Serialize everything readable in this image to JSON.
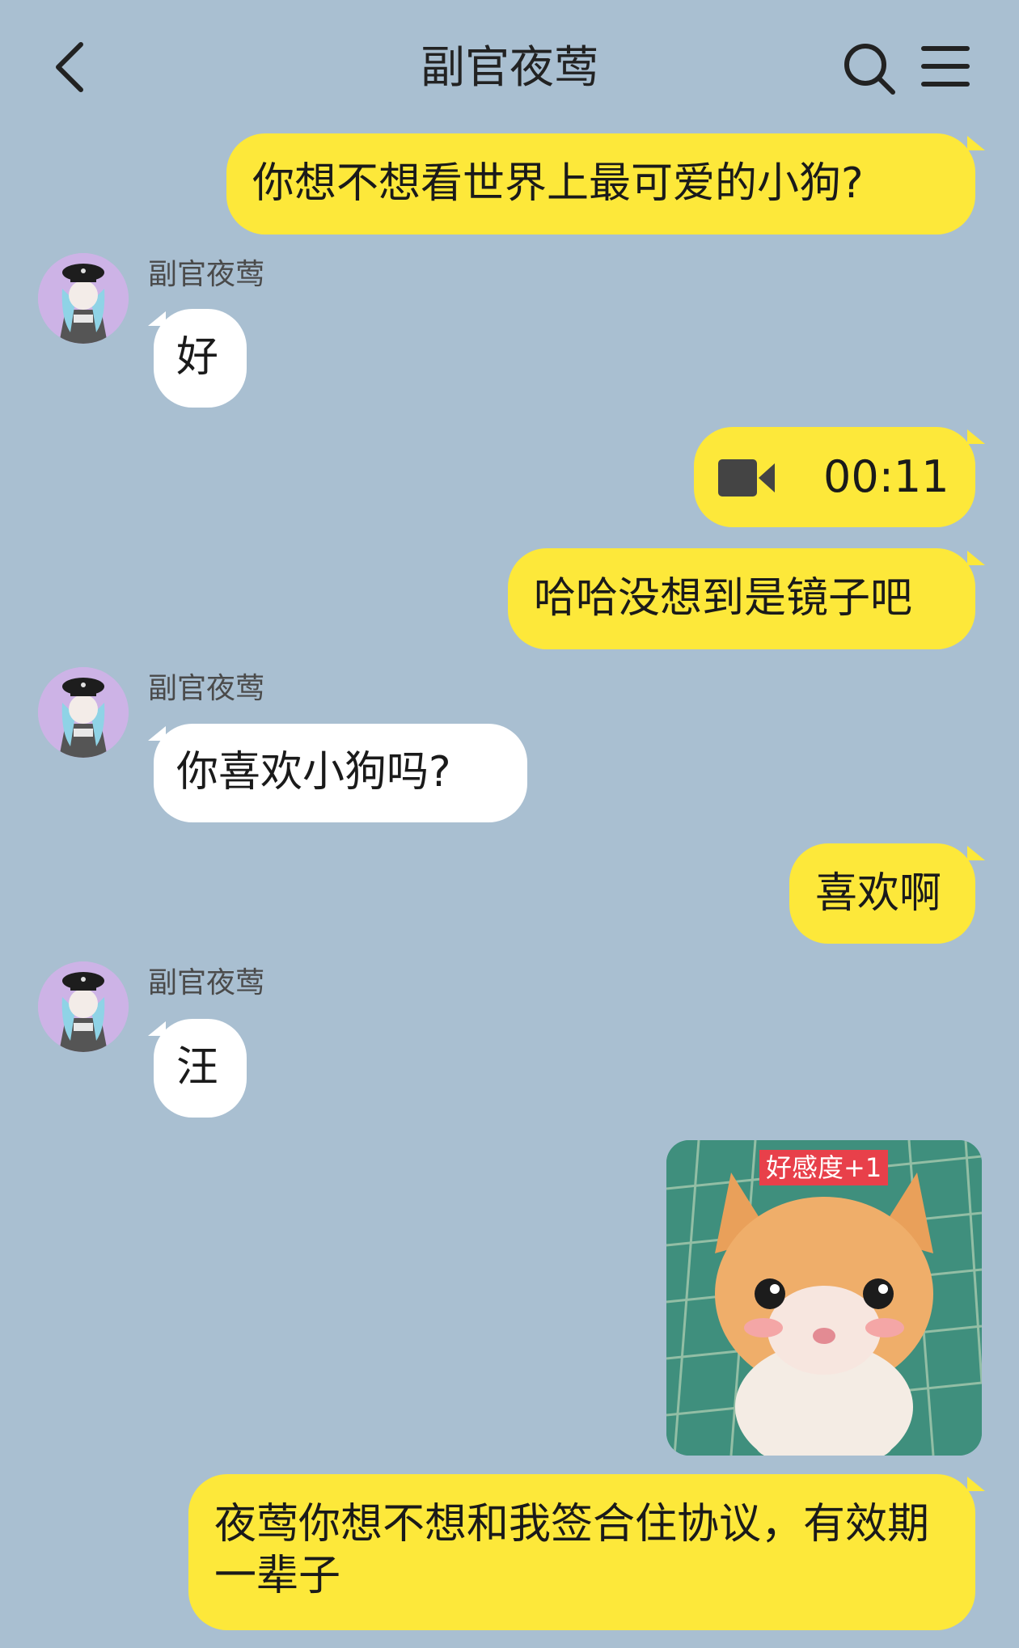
{
  "header": {
    "title": "副官夜莺",
    "back_icon": "chevron-left-icon",
    "search_icon": "search-icon",
    "menu_icon": "menu-icon"
  },
  "contact": {
    "name": "副官夜莺"
  },
  "messages": [
    {
      "from": "me",
      "type": "text",
      "text": "你想不想看世界上最可爱的小狗?"
    },
    {
      "from": "them",
      "type": "text",
      "sender": "副官夜莺",
      "text": "好"
    },
    {
      "from": "me",
      "type": "video",
      "duration": "00:11"
    },
    {
      "from": "me",
      "type": "text",
      "text": "哈哈没想到是镜子吧"
    },
    {
      "from": "them",
      "type": "text",
      "sender": "副官夜莺",
      "text": "你喜欢小狗吗?"
    },
    {
      "from": "me",
      "type": "text",
      "text": "喜欢啊"
    },
    {
      "from": "them",
      "type": "text",
      "sender": "副官夜莺",
      "text": "汪"
    },
    {
      "from": "me",
      "type": "sticker",
      "caption": "好感度+1"
    },
    {
      "from": "me",
      "type": "text",
      "text": "夜莺你想不想和我签合住协议，有效期一辈子"
    }
  ],
  "colors": {
    "background": "#a9bfd1",
    "my_bubble": "#fde83a",
    "their_bubble": "#ffffff",
    "avatar_bg": "#cdb3e6",
    "sticker_label": "#e8404a"
  }
}
